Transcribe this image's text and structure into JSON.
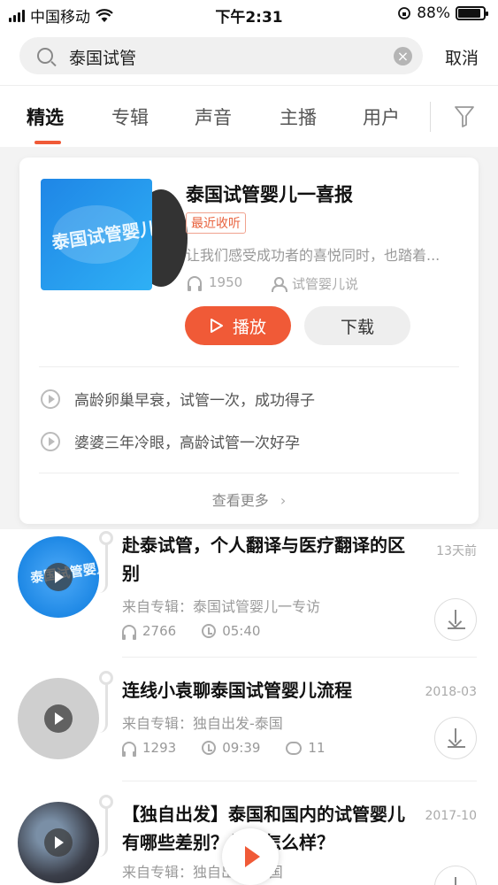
{
  "status_bar": {
    "carrier": "中国移动",
    "time": "下午2:31",
    "battery_percent": "88%",
    "battery_level": 0.88
  },
  "search": {
    "query": "泰国试管",
    "cancel_label": "取消",
    "clear_icon": "clear-icon",
    "search_icon": "search-icon"
  },
  "tabs": [
    {
      "label": "精选",
      "active": true
    },
    {
      "label": "专辑",
      "active": false
    },
    {
      "label": "声音",
      "active": false
    },
    {
      "label": "主播",
      "active": false
    },
    {
      "label": "用户",
      "active": false
    }
  ],
  "album_card": {
    "cover_text": "泰国试管婴儿",
    "title": "泰国试管婴儿一喜报",
    "badge": "最近收听",
    "description": "让我们感受成功者的喜悦同时，也踏着...",
    "plays": "1950",
    "author": "试管婴儿说",
    "play_label": "播放",
    "download_label": "下载",
    "tracks": [
      "高龄卵巢早衰，试管一次，成功得子",
      "婆婆三年冷眼，高龄试管一次好孕"
    ],
    "more_label": "查看更多"
  },
  "list": [
    {
      "title": "赴泰试管，个人翻译与医疗翻译的区别",
      "date": "13天前",
      "source": "来自专辑：泰国试管婴儿一专访",
      "plays": "2766",
      "duration": "05:40",
      "comments": null
    },
    {
      "title": "连线小袁聊泰国试管婴儿流程",
      "date": "2018-03",
      "source": "来自专辑：独自出发-泰国",
      "plays": "1293",
      "duration": "09:39",
      "comments": "11"
    },
    {
      "title": "【独自出发】泰国和国内的试管婴儿有哪些差别？价格怎么样？",
      "date": "2017-10",
      "source": "来自专辑：独自出发-泰国",
      "plays": null,
      "duration": null,
      "comments": null
    }
  ],
  "colors": {
    "accent": "#f05a37",
    "cover_blue": "#1f86e6"
  }
}
